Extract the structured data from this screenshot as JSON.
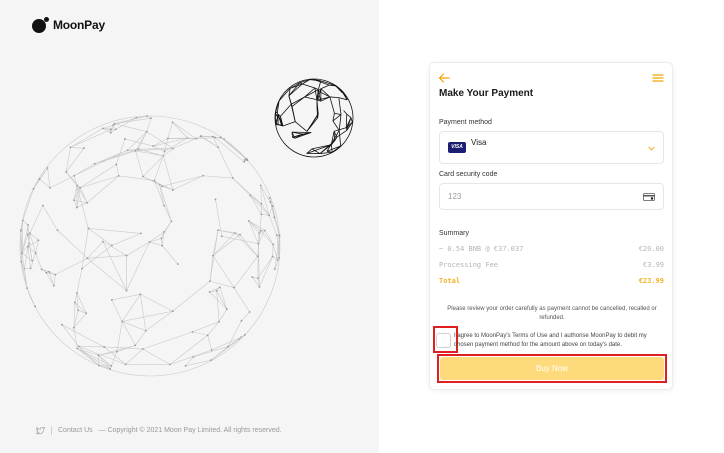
{
  "brand": {
    "name": "MoonPay"
  },
  "footer": {
    "contact": "Contact Us",
    "copyright": "— Copyright © 2021 Moon Pay Limited. All rights reserved."
  },
  "widget": {
    "title": "Make Your Payment",
    "payment_method": {
      "label": "Payment method",
      "value": "Visa",
      "card_badge": "VISA"
    },
    "security_code": {
      "label": "Card security code",
      "placeholder": "123"
    },
    "summary": {
      "label": "Summary",
      "rows": [
        {
          "label": "~ 0.54 BNB @ €37.037",
          "value": "€20.00"
        },
        {
          "label": "Processing Fee",
          "value": "€3.99"
        },
        {
          "label": "Total",
          "value": "€23.99"
        }
      ]
    },
    "notice": "Please review your order carefully as payment cannot be cancelled, recalled or refunded.",
    "agreement": "I agree to MoonPay's Terms of Use and I authorise MoonPay to debit my chosen payment method for the amount above on today's date.",
    "buy_button": "Buy Now"
  },
  "colors": {
    "accent": "#f0a500",
    "button": "#fddb7d",
    "highlight": "#e02020"
  }
}
